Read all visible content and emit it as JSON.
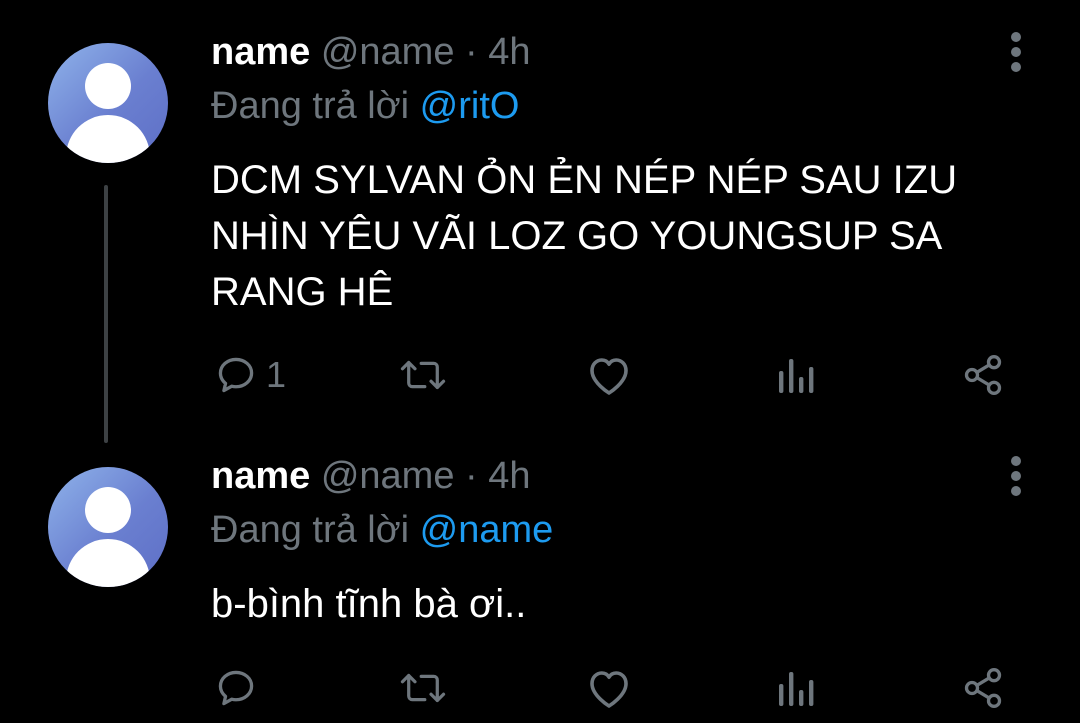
{
  "tweets": [
    {
      "display_name": "name",
      "handle": "@name",
      "separator": "·",
      "time": "4h",
      "reply_prefix": "Đang trả lời",
      "reply_to": "@ritO",
      "text": "DCM SYLVAN ỎN ẺN NÉP NÉP SAU IZU NHÌN YÊU VÃI LOZ GO YOUNGSUP SA RANG HÊ",
      "reply_count": "1"
    },
    {
      "display_name": "name",
      "handle": "@name",
      "separator": "·",
      "time": "4h",
      "reply_prefix": "Đang trả lời",
      "reply_to": "@name",
      "text": "b-bình tĩnh bà ơi..",
      "reply_count": ""
    }
  ],
  "icons": [
    "more-icon",
    "reply-icon",
    "retweet-icon",
    "like-icon",
    "analytics-icon",
    "share-icon"
  ],
  "colors": {
    "background": "#000000",
    "text": "#ffffff",
    "muted": "#6e767d",
    "mention": "#1d9bf0",
    "avatar_gradient": [
      "#8fb3ea",
      "#5e6fc6"
    ],
    "thread_line": "#3d4144"
  }
}
